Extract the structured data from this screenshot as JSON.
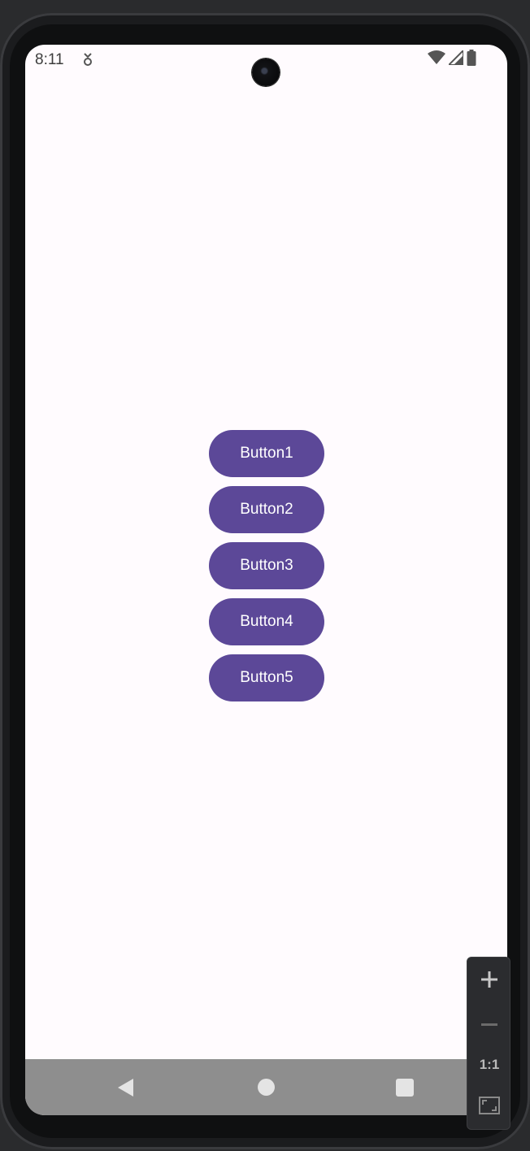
{
  "status_bar": {
    "time": "8:11",
    "notification_icon": "download-notification-icon",
    "wifi_icon": "wifi-icon",
    "signal_icon": "cell-signal-icon",
    "battery_icon": "battery-icon"
  },
  "main": {
    "buttons": [
      {
        "label": "Button1"
      },
      {
        "label": "Button2"
      },
      {
        "label": "Button3"
      },
      {
        "label": "Button4"
      },
      {
        "label": "Button5"
      }
    ]
  },
  "nav_bar": {
    "back_icon": "back-triangle-icon",
    "home_icon": "home-circle-icon",
    "recents_icon": "recents-square-icon"
  },
  "zoom_controls": {
    "actual_size_label": "1:1"
  },
  "colors": {
    "button_bg": "#5c4898",
    "button_text": "#ffffff",
    "screen_bg": "#fffbfe",
    "nav_bar_bg": "#8e8e8e"
  }
}
